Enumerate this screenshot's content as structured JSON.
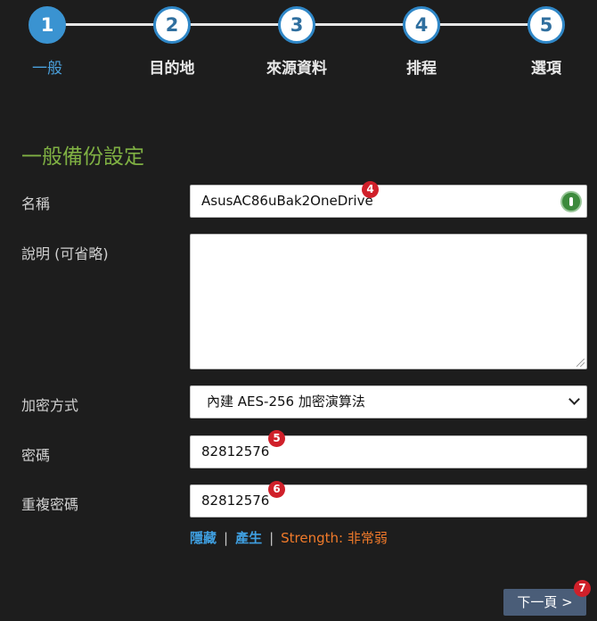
{
  "steps": [
    {
      "number": "1",
      "label": "一般"
    },
    {
      "number": "2",
      "label": "目的地"
    },
    {
      "number": "3",
      "label": "來源資料"
    },
    {
      "number": "4",
      "label": "排程"
    },
    {
      "number": "5",
      "label": "選項"
    }
  ],
  "active_step": 1,
  "section_title": "一般備份設定",
  "form": {
    "name_label": "名稱",
    "name_value": "AsusAC86uBak2OneDrive",
    "description_label": "說明 (可省略)",
    "description_value": "",
    "encryption_label": "加密方式",
    "encryption_value": "內建 AES-256 加密演算法",
    "password_label": "密碼",
    "password_value": "82812576",
    "repeat_password_label": "重複密碼",
    "repeat_password_value": "82812576"
  },
  "password_links": {
    "hide": "隱藏",
    "generate": "產生",
    "separator": "|",
    "strength": "Strength: 非常弱"
  },
  "markers": {
    "name": "4",
    "password": "5",
    "repeat_password": "6",
    "next": "7"
  },
  "next_button": "下一頁 >",
  "colors": {
    "background": "#1d1d1d",
    "accent_blue": "#3a93d1",
    "section_green": "#7fb043",
    "strength_orange": "#f07a2a",
    "marker_red": "#d0202a",
    "button_slate": "#4a5d78"
  }
}
